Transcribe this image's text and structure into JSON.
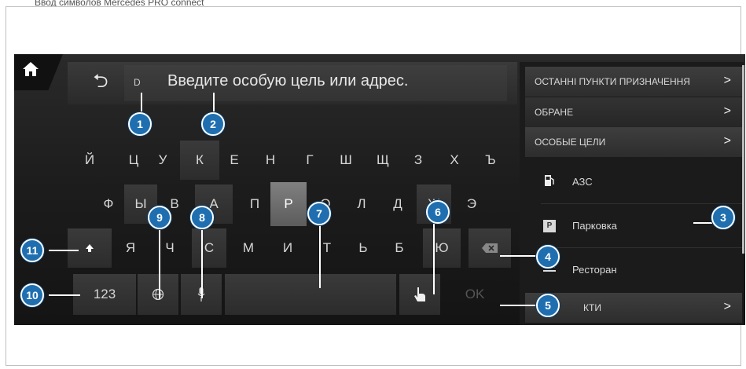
{
  "caption": "Ввод символов Mercedes PRO connect",
  "input": {
    "back_label": "⮌",
    "cursor_letter": "D",
    "placeholder": "Введите особую цель или адрес."
  },
  "keyboard": {
    "row1": [
      "Й",
      "Ц",
      "У",
      "К",
      "Е",
      "Н",
      "Г",
      "Ш",
      "Щ",
      "З",
      "Х",
      "Ъ"
    ],
    "row2": [
      "Ф",
      "Ы",
      "В",
      "А",
      "П",
      "Р",
      "О",
      "Л",
      "Д",
      "Ж",
      "Э"
    ],
    "row3": [
      "Я",
      "Ч",
      "С",
      "М",
      "И",
      "Т",
      "Ь",
      "Б",
      "Ю"
    ],
    "active_key": "Р",
    "numeric_label": "123",
    "ok_label": "OK",
    "shift_icon": "shift-arrow-icon",
    "backspace_icon": "backspace-icon",
    "language_icon": "globe-icon",
    "voice_icon": "microphone-icon",
    "handwriting_icon": "touch-hand-icon"
  },
  "right_panel": {
    "headers": [
      {
        "label": "ОСТАННІ ПУНКТИ ПРИЗНАЧЕННЯ",
        "chevron": ">"
      },
      {
        "label": "ОБРАНЕ",
        "chevron": ">"
      },
      {
        "label": "ОСОБЫЕ ЦЕЛИ",
        "chevron": ">"
      }
    ],
    "items": [
      {
        "label": "АЗС",
        "icon": "fuel-pump-icon"
      },
      {
        "label": "Парковка",
        "icon": "parking-icon",
        "icon_text": "P"
      },
      {
        "label": "Ресторан",
        "icon": "restaurant-icon"
      }
    ],
    "footer": {
      "label": "КТИ",
      "chevron": ">"
    }
  },
  "callouts": [
    "1",
    "2",
    "3",
    "4",
    "5",
    "6",
    "7",
    "8",
    "9",
    "10",
    "11"
  ],
  "colors": {
    "callout": "#1f6fb0",
    "screen": "#1c1c1c",
    "key_active": "#6e6e6e"
  }
}
